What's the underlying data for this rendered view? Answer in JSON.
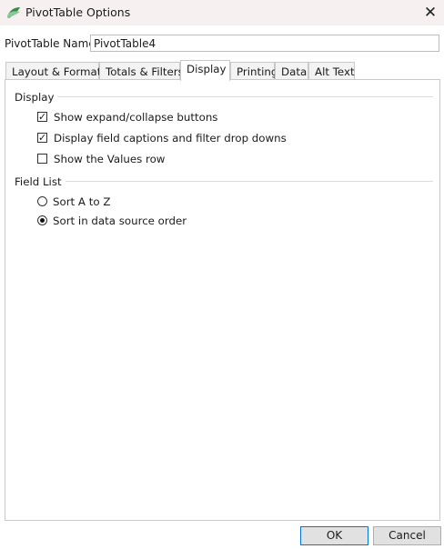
{
  "window": {
    "title": "PivotTable Options",
    "close_glyph": "✕"
  },
  "name_row": {
    "label": "PivotTable Name:",
    "value": "PivotTable4"
  },
  "tabs": [
    {
      "label": "Layout & Format",
      "active": false
    },
    {
      "label": "Totals & Filters",
      "active": false
    },
    {
      "label": "Display",
      "active": true
    },
    {
      "label": "Printing",
      "active": false
    },
    {
      "label": "Data",
      "active": false
    },
    {
      "label": "Alt Text",
      "active": false
    }
  ],
  "display_group": {
    "title": "Display",
    "options": [
      {
        "label": "Show expand/collapse buttons",
        "checked": true
      },
      {
        "label": "Display field captions and filter drop downs",
        "checked": true
      },
      {
        "label": "Show the Values row",
        "checked": false
      }
    ]
  },
  "field_list_group": {
    "title": "Field List",
    "options": [
      {
        "label": "Sort A to Z",
        "selected": false
      },
      {
        "label": "Sort in data source order",
        "selected": true
      }
    ]
  },
  "buttons": {
    "ok": "OK",
    "cancel": "Cancel"
  },
  "colors": {
    "title_bar": "#f7f0f0",
    "icon_green": "#3a8a4a",
    "default_button_border": "#0078d7"
  }
}
